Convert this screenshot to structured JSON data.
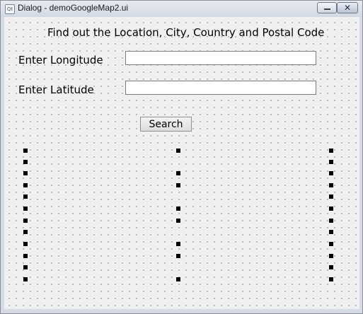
{
  "window": {
    "title": "Dialog - demoGoogleMap2.ui",
    "icon": "qt-icon",
    "icon_glyph": "Qt"
  },
  "titlebar_buttons": {
    "minimize_icon": "minimize-icon",
    "close_icon": "close-icon",
    "close_glyph": "✕"
  },
  "form": {
    "heading": "Find out the Location, City, Country and Postal Code",
    "longitude_label": "Enter Longitude",
    "longitude_value": "",
    "latitude_label": "Enter Latitude",
    "latitude_value": "",
    "search_label": "Search"
  }
}
